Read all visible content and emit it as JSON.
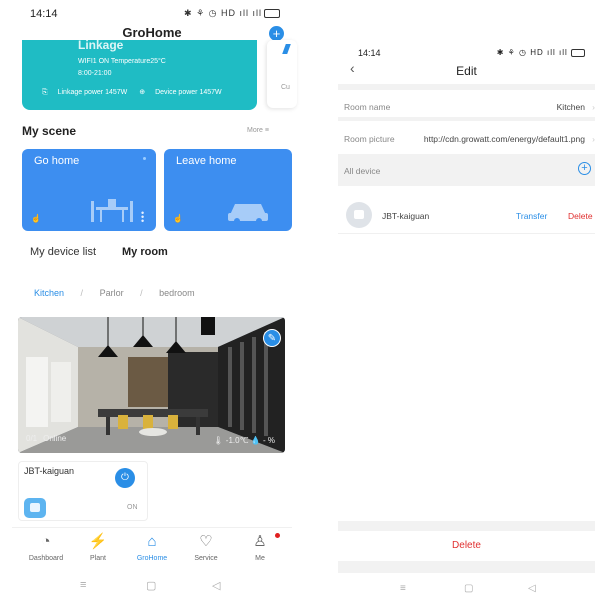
{
  "left": {
    "status": {
      "time": "14:14",
      "icons": "✱ ⚘ ◷ HD ıll ıll",
      "battery_label": ""
    },
    "app_title": "GroHome",
    "add_icon": "plus-icon",
    "linkage": {
      "title": "Linkage",
      "line1": "WIFI1  ON Temperature25°C",
      "line2": "8:00-21:00",
      "linkage_power": "Linkage power 1457W",
      "device_power": "Device power 1457W",
      "peek_text": "Cu"
    },
    "scene_section": {
      "title": "My scene",
      "more": "More  ≡"
    },
    "scenes": [
      {
        "name": "Go home"
      },
      {
        "name": "Leave home"
      }
    ],
    "tabs": {
      "device_list": "My device list",
      "room": "My room"
    },
    "room_tabs": [
      "Kitchen",
      "Parlor",
      "bedroom"
    ],
    "room_tab_sep": "/",
    "photo": {
      "count": "0/1",
      "status": "Online",
      "temperature": "-1.0℃",
      "humidity": "- %"
    },
    "device": {
      "name": "JBT-kaiguan",
      "state": "ON"
    },
    "nav": [
      {
        "label": "Dashboard",
        "icon": "dashboard-icon",
        "glyph": "◔"
      },
      {
        "label": "Plant",
        "icon": "plant-icon",
        "glyph": "⚡"
      },
      {
        "label": "GroHome",
        "icon": "home-icon",
        "glyph": "⌂"
      },
      {
        "label": "Service",
        "icon": "service-icon",
        "glyph": "♡"
      },
      {
        "label": "Me",
        "icon": "me-icon",
        "glyph": "♙"
      }
    ],
    "sysnav": {
      "menu": "≡",
      "home": "▢",
      "back": "◁"
    }
  },
  "right": {
    "status": {
      "time": "14:14",
      "icons": "✱ ⚘ ◷ HD ıll ıll"
    },
    "back": "‹",
    "title": "Edit",
    "room_name": {
      "label": "Room name",
      "value": "Kitchen"
    },
    "room_picture": {
      "label": "Room picture",
      "value": "http://cdn.growatt.com/energy/default1.png"
    },
    "chevron": "›",
    "all_device": {
      "label": "All device",
      "add": "+"
    },
    "device": {
      "name": "JBT-kaiguan",
      "transfer": "Transfer",
      "delete": "Delete"
    },
    "delete_button": "Delete",
    "sysnav": {
      "menu": "≡",
      "home": "▢",
      "back": "◁"
    }
  },
  "colors": {
    "accent": "#2a8ee6",
    "linkage": "#1fbcc4",
    "scene": "#3d8ef0",
    "danger": "#e03030"
  }
}
